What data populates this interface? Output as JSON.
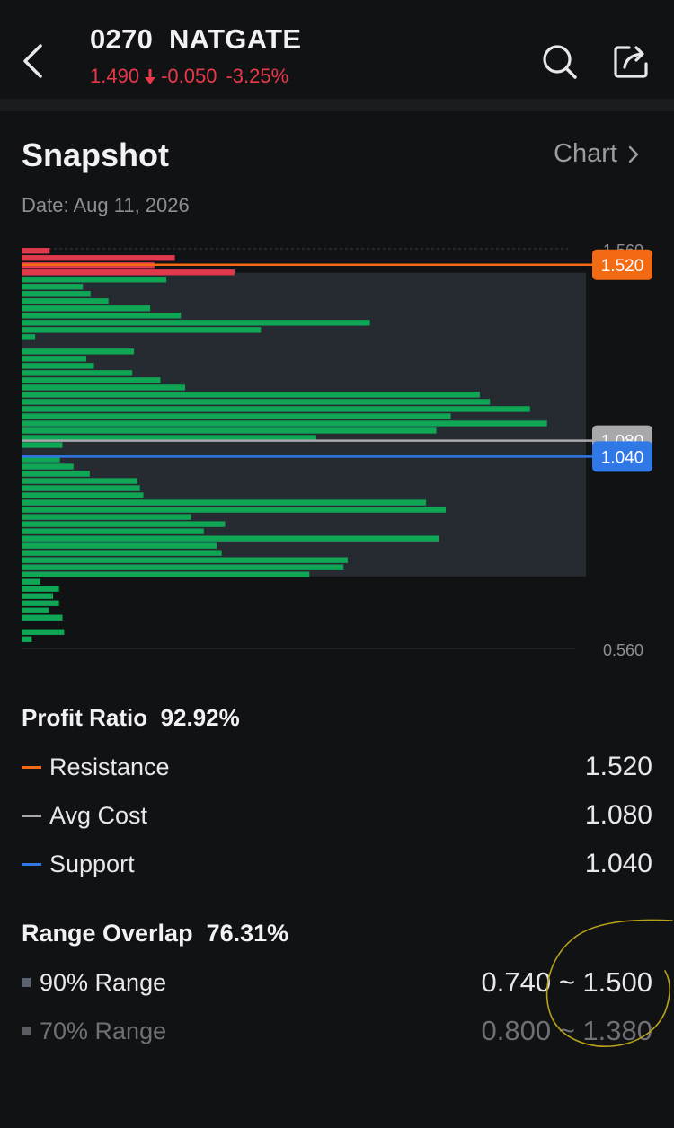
{
  "header": {
    "code": "0270",
    "name": "NATGATE",
    "price": "1.490",
    "change": "-0.050",
    "change_pct": "-3.25%",
    "price_color": "#e8394a",
    "icons": [
      "chevron-left-icon",
      "down-arrow-icon",
      "search-icon",
      "share-icon"
    ]
  },
  "snapshot": {
    "title": "Snapshot",
    "chart_link": "Chart",
    "date": "Date: Aug 11, 2026"
  },
  "chart_data": {
    "type": "bar",
    "orientation": "horizontal",
    "y_top_label": "1.560",
    "y_bottom_label": "0.560",
    "ylim": [
      0.56,
      1.56
    ],
    "price_levels": [
      1.555,
      1.537,
      1.519,
      1.501,
      1.483,
      1.465,
      1.447,
      1.429,
      1.411,
      1.393,
      1.375,
      1.357,
      1.339,
      1.321,
      1.303,
      1.285,
      1.267,
      1.249,
      1.231,
      1.213,
      1.195,
      1.177,
      1.159,
      1.141,
      1.123,
      1.105,
      1.087,
      1.069,
      1.051,
      1.033,
      1.015,
      0.997,
      0.979,
      0.961,
      0.943,
      0.925,
      0.907,
      0.889,
      0.871,
      0.853,
      0.835,
      0.817,
      0.799,
      0.781,
      0.763,
      0.745,
      0.727,
      0.709,
      0.691,
      0.673,
      0.655,
      0.637,
      0.619,
      0.601,
      0.583,
      0.565
    ],
    "distribution": [
      3.3,
      18.0,
      15.6,
      25.0,
      17.0,
      7.2,
      8.1,
      10.2,
      15.1,
      18.7,
      40.9,
      28.1,
      1.6,
      0,
      13.2,
      7.6,
      8.5,
      13.0,
      16.3,
      19.2,
      53.8,
      55.0,
      59.7,
      50.4,
      61.7,
      48.7,
      34.6,
      4.8,
      0,
      4.5,
      6.1,
      8.0,
      13.6,
      13.9,
      14.3,
      47.5,
      49.8,
      19.9,
      23.9,
      21.4,
      49.0,
      22.9,
      23.5,
      38.3,
      37.8,
      33.8,
      2.2,
      4.4,
      3.7,
      4.4,
      3.2,
      4.8,
      0,
      5.0,
      1.2,
      0
    ],
    "loss_levels_above": 1.49,
    "colors": {
      "profit": "#0fa756",
      "loss": "#e0394b",
      "range_band": "#262a31"
    },
    "range_90": [
      0.74,
      1.5
    ],
    "resistance": {
      "value": 1.52,
      "label": "1.520",
      "color": "#f26a13"
    },
    "avg_cost": {
      "value": 1.08,
      "label": "1.080",
      "color": "#a9a9ad"
    },
    "support": {
      "value": 1.04,
      "label": "1.040",
      "color": "#2f78e6"
    }
  },
  "profit": {
    "label": "Profit Ratio",
    "value": "92.92%"
  },
  "legend": [
    {
      "label": "Resistance",
      "value": "1.520",
      "color": "#f26a13"
    },
    {
      "label": "Avg Cost",
      "value": "1.080",
      "color": "#a9a9ad"
    },
    {
      "label": "Support",
      "value": "1.040",
      "color": "#2f78e6"
    }
  ],
  "overlap": {
    "label": "Range Overlap",
    "value": "76.31%"
  },
  "ranges": [
    {
      "label": "90% Range",
      "low": "0.740",
      "high": "1.500",
      "tilde": "~",
      "color": "#e8e8ea",
      "sq": "#5b6270"
    },
    {
      "label": "70% Range",
      "low": "0.800",
      "high": "1.380",
      "tilde": "~",
      "color": "#6e7076",
      "sq": "#5a5c62"
    }
  ]
}
